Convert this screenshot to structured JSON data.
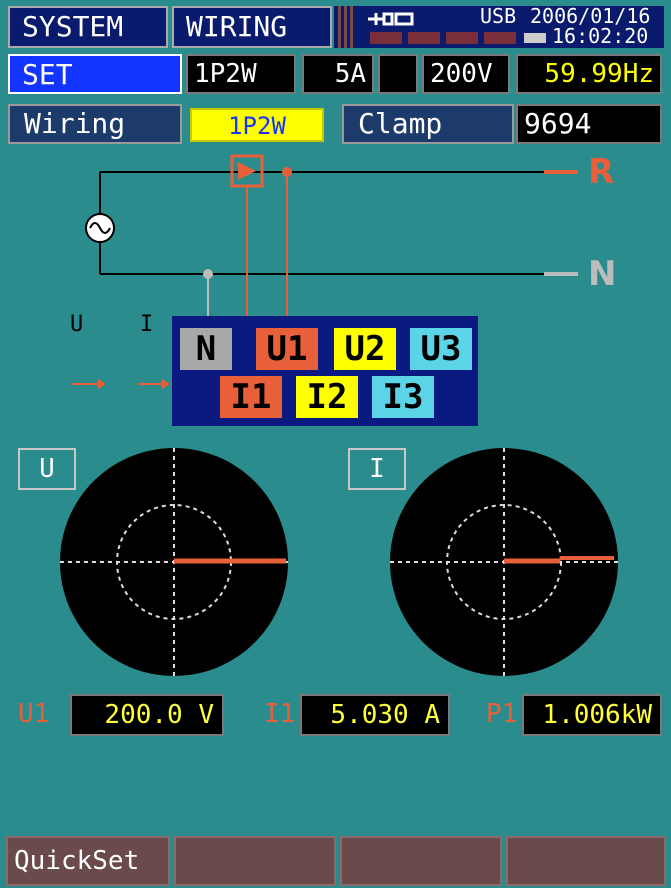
{
  "header": {
    "tab_system": "SYSTEM",
    "tab_wiring": "WIRING",
    "usb_label": "USB",
    "date": "2006/01/16",
    "time": "16:02:20"
  },
  "settings_row": {
    "mode": "SET",
    "wiring": "1P2W",
    "current_range": "5A",
    "voltage_range": "200V",
    "frequency": "59.99Hz"
  },
  "config_row": {
    "wiring_label": "Wiring",
    "wiring_value": "1P2W",
    "clamp_label": "Clamp",
    "clamp_value": "9694"
  },
  "diagram": {
    "line_r": "R",
    "line_n": "N",
    "col_u": "U",
    "col_i": "I",
    "terminals_top": [
      "N",
      "U1",
      "U2",
      "U3"
    ],
    "terminals_bottom": [
      "I1",
      "I2",
      "I3"
    ]
  },
  "vectors": {
    "u_label": "U",
    "i_label": "I"
  },
  "measurements": [
    {
      "label": "U1",
      "value": "200.0 V"
    },
    {
      "label": "I1",
      "value": "5.030 A"
    },
    {
      "label": "P1",
      "value": "1.006kW"
    }
  ],
  "function_keys": [
    "QuickSet",
    "",
    "",
    ""
  ],
  "colors": {
    "background": "#2b8c8e",
    "accent_red": "#e8603a",
    "highlight_yellow": "#ffff00",
    "set_blue": "#1434ff"
  }
}
